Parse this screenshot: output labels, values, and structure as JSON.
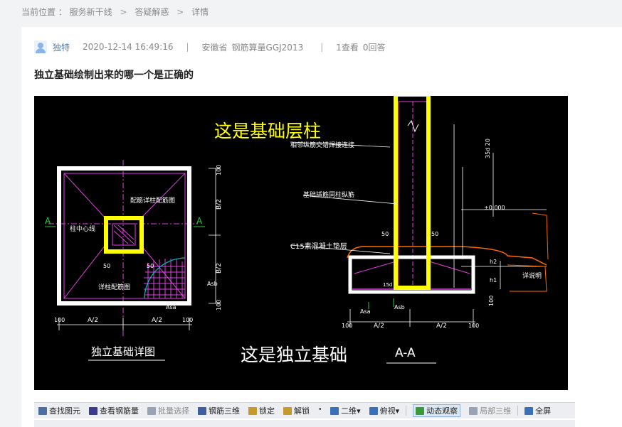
{
  "breadcrumb": {
    "label": "当前位置 ：",
    "items": [
      "服务新干线",
      "答疑解惑",
      "详情"
    ],
    "separator": ">"
  },
  "post": {
    "author": "独特",
    "datetime": "2020-12-14 16:49:16",
    "region": "安徽省",
    "product": "钢筋算量GGJ2013",
    "views": "1查看",
    "answers": "0回答",
    "divider": "|",
    "title": "独立基础绘制出来的哪一个是正确的"
  },
  "figure": {
    "annotation_top": "这是基础层柱",
    "annotation_bottom": "这是独立基础",
    "left_caption": "独立基础详图",
    "section_caption": "A-A",
    "section_marker": "A",
    "left_labels": {
      "rebar_note": "配筋详柱配筋图",
      "col_center": "柱中心线",
      "col_side": "柱中心线",
      "detail_note": "详柱配筋图",
      "asb": "Asb",
      "asa": "Asa",
      "b2_top": "B/2",
      "b2_bottom": "B/2",
      "a2_left": "A/2",
      "a2_right": "A/2",
      "dim_100a": "100",
      "dim_100b": "100",
      "dim_50a": "50",
      "dim_50b": "50"
    },
    "right_labels": {
      "lap_note": "相邻纵筋交错焊接连接",
      "anchor_note": "基础插筋同柱纵筋",
      "cushion_note": "C15素混凝土垫层",
      "anchor_len": "35d",
      "anchor_len2": "35d 20",
      "elev": "±0.000",
      "detail_ref": "详说明",
      "asa": "Asa",
      "asb": "Asb",
      "a2_left": "A/2",
      "a2_right": "A/2",
      "dim_100a": "100",
      "dim_100b": "100",
      "h1": "h1",
      "h2": "h2",
      "dim_50a": "50",
      "dim_50b": "50",
      "dim_100c": "100",
      "len_15d": "15d"
    }
  },
  "toolbar": {
    "items": [
      {
        "label": "查找图元",
        "icon": "binoculars-icon",
        "color": "#4a6fa5"
      },
      {
        "label": "查看钢筋量",
        "icon": "rebar-quantity-icon",
        "color": "#3b3b8f"
      },
      {
        "label": "批量选择",
        "icon": "batch-select-icon",
        "color": "#9aa3b5",
        "disabled": true
      },
      {
        "label": "钢筋三维",
        "icon": "rebar-3d-icon",
        "color": "#3b5fa0"
      },
      {
        "label": "锁定",
        "icon": "lock-icon",
        "color": "#c69a2a"
      },
      {
        "label": "解锁",
        "icon": "unlock-icon",
        "color": "#c69a2a"
      },
      {
        "label": "二维",
        "icon": "2d-view-icon",
        "color": "#3b6fb7",
        "dropdown": true
      },
      {
        "label": "俯视",
        "icon": "top-view-icon",
        "color": "#3b6fb7",
        "dropdown": true
      },
      {
        "label": "动态观察",
        "icon": "dynamic-orbit-icon",
        "color": "#3a9a3a",
        "active": true
      },
      {
        "label": "局部三维",
        "icon": "local-3d-icon",
        "color": "#9aa3b5",
        "disabled": true
      },
      {
        "label": "全屏",
        "icon": "fullscreen-icon",
        "color": "#3b6fb7"
      }
    ],
    "quote_mark": "\""
  },
  "colors": {
    "highlight": "#ffff00",
    "cad_magenta": "#e040e0",
    "cad_white": "#ffffff",
    "cad_orange": "#ff6a00",
    "cad_green": "#2ecc40",
    "cad_cyan": "#00c0d0"
  }
}
